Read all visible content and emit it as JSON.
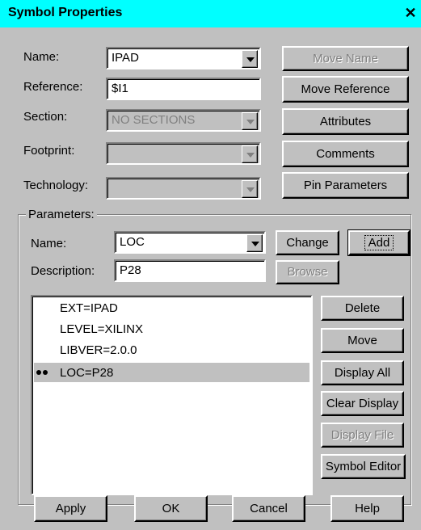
{
  "window": {
    "title": "Symbol Properties",
    "close_glyph": "✕"
  },
  "fields": {
    "name": {
      "label": "Name:",
      "value": "IPAD"
    },
    "reference": {
      "label": "Reference:",
      "value": "$I1"
    },
    "section": {
      "label": "Section:",
      "value": "NO SECTIONS"
    },
    "footprint": {
      "label": "Footprint:",
      "value": ""
    },
    "technology": {
      "label": "Technology:",
      "value": ""
    }
  },
  "side_buttons": {
    "move_name": "Move Name",
    "move_reference": "Move Reference",
    "attributes": "Attributes",
    "comments": "Comments",
    "pin_parameters": "Pin Parameters"
  },
  "parameters": {
    "group_label": "Parameters:",
    "name_label": "Name:",
    "name_value": "LOC",
    "description_label": "Description:",
    "description_value": "P28",
    "change": "Change",
    "add": "Add",
    "browse": "Browse",
    "list": [
      "EXT=IPAD",
      "LEVEL=XILINX",
      "LIBVER=2.0.0",
      "LOC=P28"
    ],
    "selected_index": 3
  },
  "list_buttons": {
    "delete": "Delete",
    "move": "Move",
    "display_all": "Display All",
    "clear_display": "Clear Display",
    "display_file": "Display File",
    "symbol_editor": "Symbol Editor"
  },
  "bottom_buttons": {
    "apply": "Apply",
    "ok": "OK",
    "cancel": "Cancel",
    "help": "Help"
  }
}
